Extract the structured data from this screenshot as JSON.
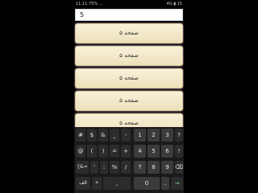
{
  "status": {
    "time": "11:11",
    "left_indicators": "75% ...",
    "right_indicators": "4G ▮ 15"
  },
  "search": {
    "value": "5"
  },
  "results": [
    {
      "label": "صفحه ۵"
    },
    {
      "label": "صفحه ۵"
    },
    {
      "label": "صفحه ۵"
    },
    {
      "label": "صفحه ۵"
    },
    {
      "label": "صفحه ۵"
    }
  ],
  "keyboard": {
    "rows": [
      [
        "#",
        "$",
        "&",
        "_",
        "-",
        "1",
        "2",
        "3",
        "?"
      ],
      [
        "@",
        "(",
        ")",
        "=",
        "+",
        "4",
        "5",
        "6",
        "!"
      ],
      [
        "{&=",
        "'",
        ":",
        "%",
        "/",
        "7",
        "8",
        "9",
        "⌫"
      ],
      [
        "الف",
        "*",
        ",",
        "0",
        ".",
        "→"
      ]
    ]
  }
}
